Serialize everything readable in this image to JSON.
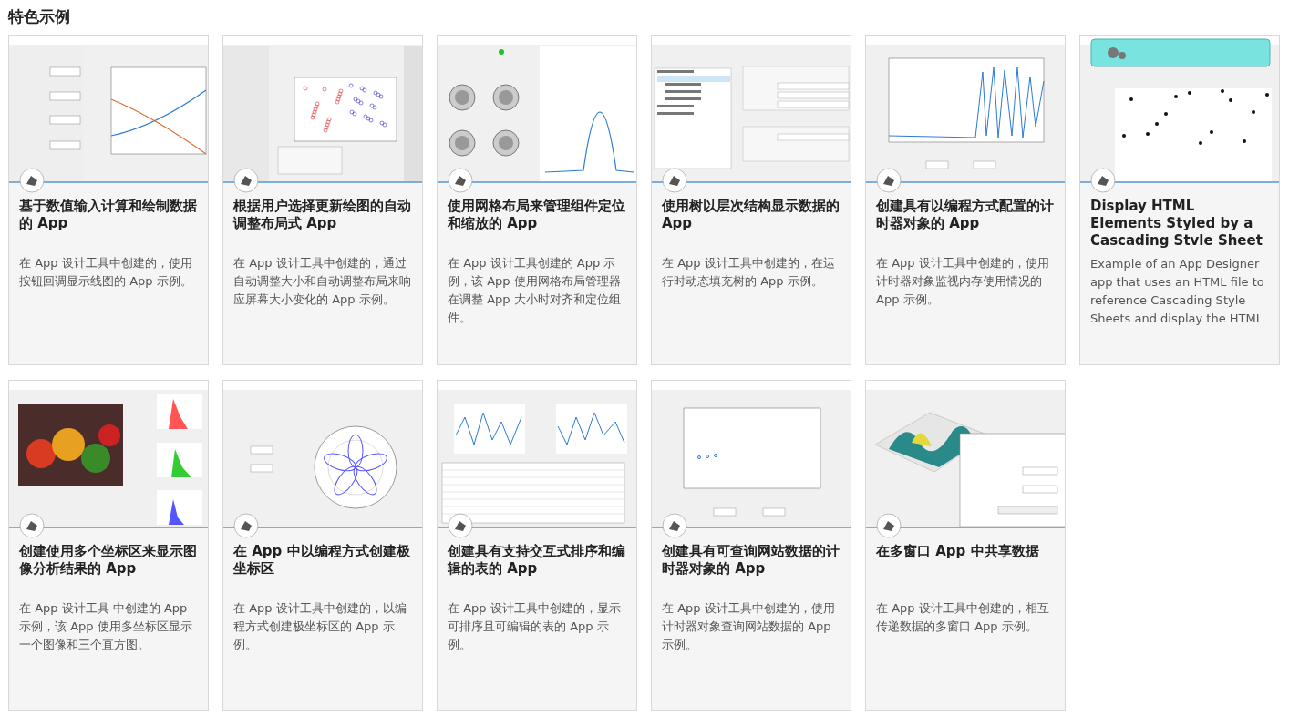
{
  "heading": "特色示例",
  "cards": [
    {
      "kind": "lines",
      "title": "基于数值输入计算和绘制数据的 App",
      "description": "在 App 设计工具中创建的，使用按钮回调显示线图的 App 示例。"
    },
    {
      "kind": "scatter",
      "title": "根据用户选择更新绘图的自动调整布局式 App",
      "description": "在 App 设计工具中创建的，通过自动调整大小和自动调整布局来响应屏幕大小变化的 App 示例。"
    },
    {
      "kind": "knobs",
      "title": "使用网格布局来管理组件定位和缩放的 App",
      "description": "在 App 设计工具创建的 App 示例，该 App 使用网格布局管理器在调整 App 大小时对齐和定位组件。"
    },
    {
      "kind": "tree",
      "title": "使用树以层次结构显示数据的 App",
      "description": "在 App 设计工具中创建的，在运行时动态填充树的 App 示例。"
    },
    {
      "kind": "timer",
      "title": "创建具有以编程方式配置的计时器对象的 App",
      "description": "在 App 设计工具中创建的，使用计时器对象监视内存使用情况的 App 示例。"
    },
    {
      "kind": "random",
      "title": "Display HTML Elements Styled by a Cascading Stvle Sheet",
      "description": "Example of an App Designer app that uses an HTML file to reference Cascading Style Sheets and display the HTML"
    },
    {
      "kind": "image",
      "title": "创建使用多个坐标区来显示图像分析结果的 App",
      "description": "在 App 设计工具 中创建的 App 示例，该 App 使用多坐标区显示一个图像和三个直方图。"
    },
    {
      "kind": "polar",
      "title": "在 App 中以编程方式创建极坐标区",
      "description": "在 App 设计工具中创建的，以编程方式创建极坐标区的 App 示例。"
    },
    {
      "kind": "table",
      "title": "创建具有支持交互式排序和编辑的表的 App",
      "description": "在 App 设计工具中创建的，显示可排序且可编辑的表的 App 示例。"
    },
    {
      "kind": "wind",
      "title": "创建具有可查询网站数据的计时器对象的 App",
      "description": "在 App 设计工具中创建的，使用计时器对象查询网站数据的 App 示例。"
    },
    {
      "kind": "surface",
      "title": "在多窗口 App 中共享数据",
      "description": "在 App 设计工具中创建的，相互传递数据的多窗口 App 示例。"
    }
  ]
}
